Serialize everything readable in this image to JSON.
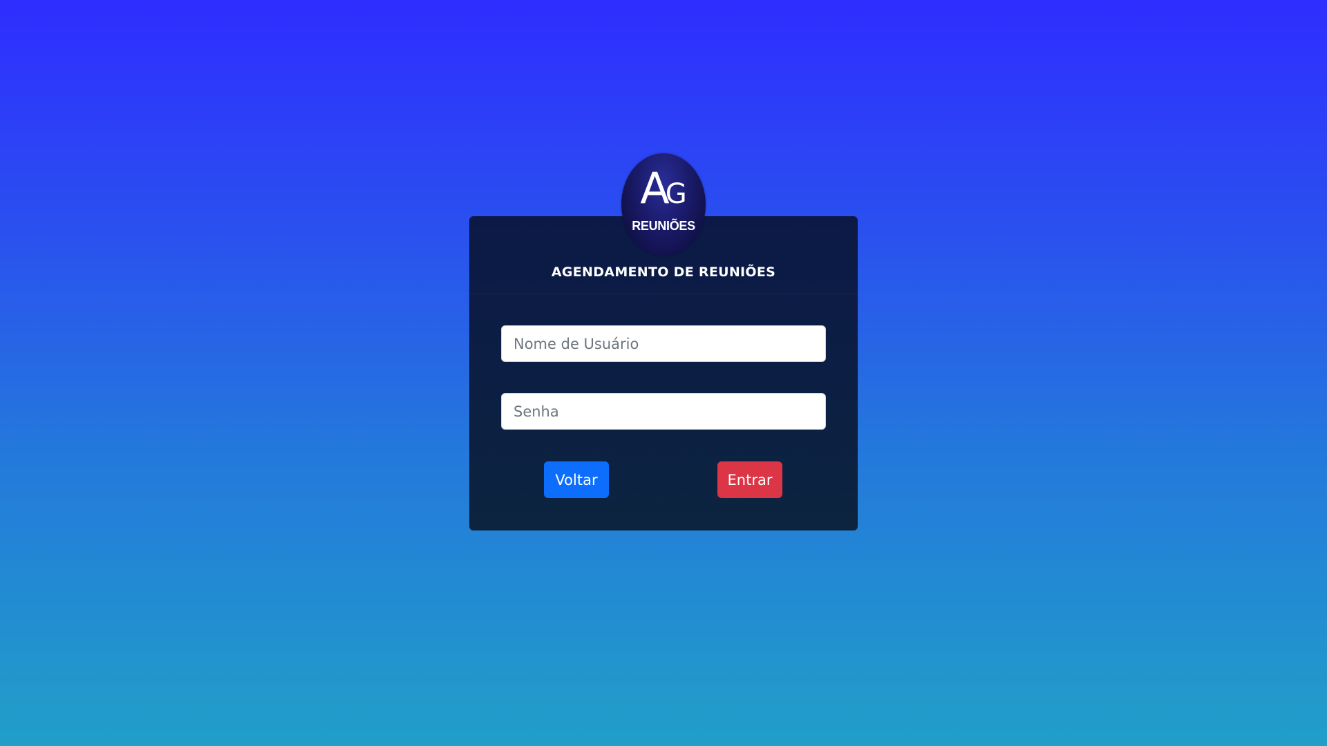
{
  "login": {
    "logo": {
      "letter_big": "A",
      "letter_small": "G",
      "subtitle": "REUNIÕES"
    },
    "title": "AGENDAMENTO DE REUNIÕES",
    "username": {
      "placeholder": "Nome de Usuário",
      "value": ""
    },
    "password": {
      "placeholder": "Senha",
      "value": ""
    },
    "back_label": "Voltar",
    "enter_label": "Entrar"
  },
  "colors": {
    "background_top": "#2f2dff",
    "background_bottom": "#219fc8",
    "card": "#0c1947",
    "back_button": "#0d6efd",
    "enter_button": "#dc3545"
  }
}
